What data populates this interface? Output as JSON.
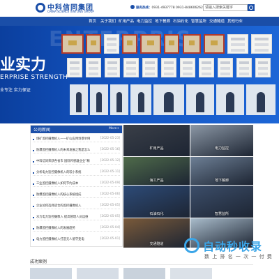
{
  "header": {
    "logo_name": "中科信同集团",
    "logo_subtitle": "CHINA SCIENCE XINTONG GROUP",
    "hotline_label": "服务热线：",
    "hotline_value": "0931-4937778 0931-8486062624",
    "search_placeholder": "请输入搜索关键字"
  },
  "nav": {
    "items": [
      "首页",
      "关于我们",
      "矿用产品",
      "电力监控",
      "地下餐廊",
      "石油石化",
      "智慧监所",
      "交通隧道",
      "其他行业"
    ]
  },
  "banner": {
    "ghost_text": "ENTERPRIS",
    "title": "业实力",
    "subtitle": "ERPRISE STRENGTH",
    "slogan": "业专注  实力保证"
  },
  "news": {
    "title": "公司新闻",
    "more": "More+",
    "items": [
      {
        "text": "煤矿监控摄像机入——矿山应用场景举例",
        "date": "[2022-05-23]"
      },
      {
        "text": "防爆监控摄像机入的未来发展之我是怎么",
        "date": "[2022-05-16]"
      },
      {
        "text": "中科信同荣获各省市 国际传感器业业”精",
        "date": "[2022-05-12]"
      },
      {
        "text": "分析电力监控摄像机入的较小系统",
        "date": "[2022-05-11]"
      },
      {
        "text": "工业监控摄像机入如何节约成本",
        "date": "[2022-05-09]"
      },
      {
        "text": "防爆监控摄像机入的核心系统组成",
        "date": "[2022-05-06]"
      },
      {
        "text": "企业如何选择适合的监控摄像机入",
        "date": "[2022-05-05]"
      },
      {
        "text": "水力电力监控摄像入 提高管理人员运维",
        "date": "[2022-05-05]"
      },
      {
        "text": "防爆监控摄像机入的发展趋势",
        "date": "[2022-05-04]"
      },
      {
        "text": "电力监控摄像机入打造无人值守变电",
        "date": "[2022-05-01]"
      }
    ]
  },
  "tiles": [
    {
      "label": "矿用产品",
      "color": "#3a3f48"
    },
    {
      "label": "电力监控",
      "color": "#8c98a6"
    },
    {
      "label": "海工产品",
      "color": "#4f6b4a"
    },
    {
      "label": "地下餐廊",
      "color": "#6d7f95"
    },
    {
      "label": "石油石化",
      "color": "#2d4b78"
    },
    {
      "label": "智慧监所",
      "color": "#3c4e6a"
    },
    {
      "label": "交通隧道",
      "color": "#7a5a3a"
    },
    {
      "label": "",
      "color": "#a9bccb"
    }
  ],
  "cases": {
    "title": "成功案例"
  },
  "watermark": {
    "title": "自动秒收录",
    "subtitle": "数 上 排 名 一 次 一 付 费"
  }
}
